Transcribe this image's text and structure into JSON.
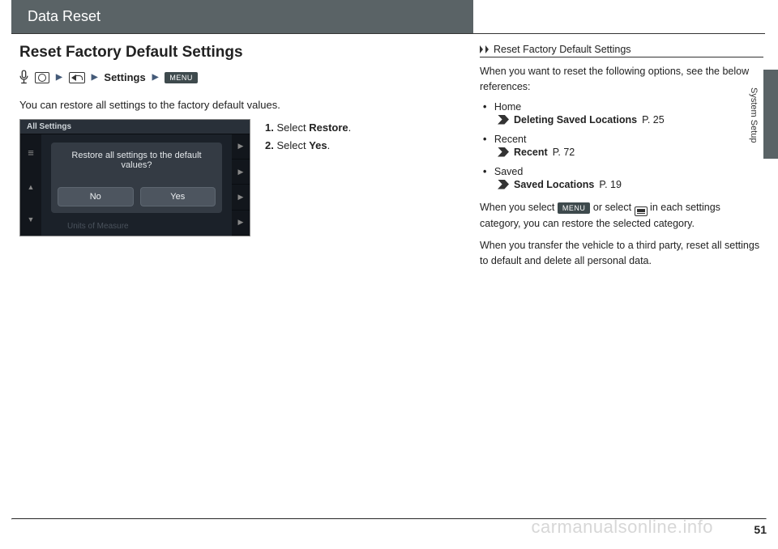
{
  "titleBar": "Data Reset",
  "sectionTitle": "Reset Factory Default Settings",
  "navPath": {
    "settings": "Settings",
    "menu": "MENU"
  },
  "introText": "You can restore all settings to the factory default values.",
  "screenshot": {
    "header": "All Settings",
    "dialogText": "Restore all settings to the default values?",
    "btnNo": "No",
    "btnYes": "Yes",
    "faded": "Units of Measure",
    "arrows": {
      "ham": "≡",
      "up": "▲",
      "down": "▼",
      "right": "▶"
    }
  },
  "steps": {
    "s1num": "1.",
    "s1a": "Select ",
    "s1b": "Restore",
    "s1c": ".",
    "s2num": "2.",
    "s2a": "Select ",
    "s2b": "Yes",
    "s2c": "."
  },
  "side": {
    "header": "Reset Factory Default Settings",
    "intro": "When you want to reset the following options, see the below references:",
    "items": [
      {
        "label": "Home",
        "linkText": "Deleting Saved Locations",
        "page": "P. 25"
      },
      {
        "label": "Recent",
        "linkText": "Recent",
        "page": "P. 72"
      },
      {
        "label": "Saved",
        "linkText": "Saved Locations",
        "page": "P. 19"
      }
    ],
    "para2a": "When you select ",
    "para2menu": "MENU",
    "para2b": " or select ",
    "para2c": " in each settings category, you can restore the selected category.",
    "para3": "When you transfer the vehicle to a third party, reset all settings to default and delete all personal data."
  },
  "sideTab": "System Setup",
  "pageNum": "51",
  "watermark": "carmanualsonline.info"
}
